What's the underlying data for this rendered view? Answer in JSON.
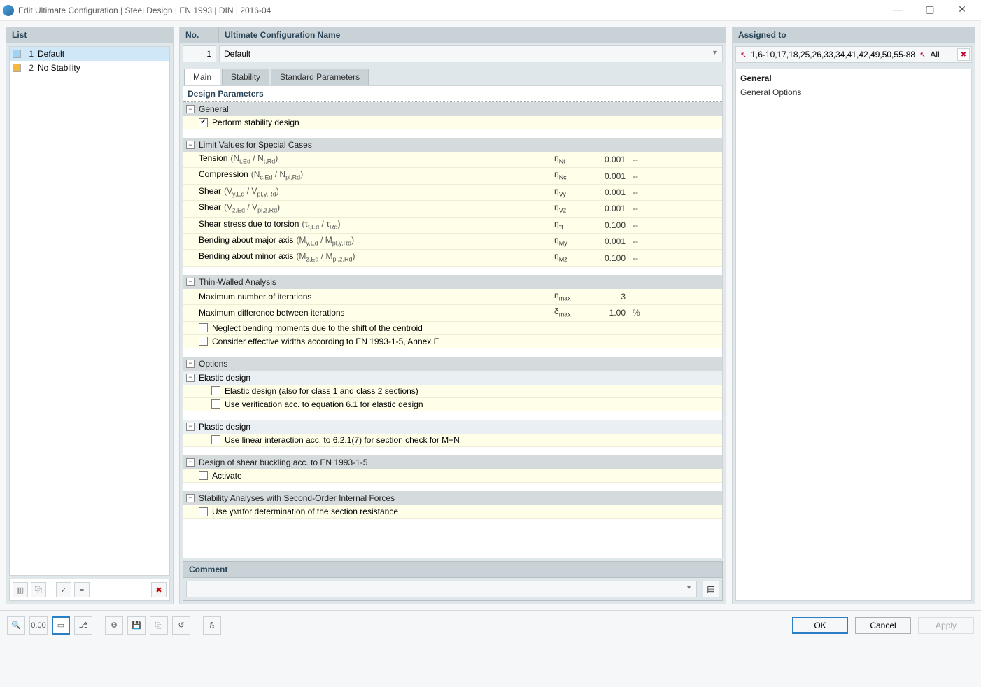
{
  "window_title": "Edit Ultimate Configuration | Steel Design | EN 1993 | DIN | 2016-04",
  "list": {
    "header": "List",
    "items": [
      {
        "num": "1",
        "label": "Default",
        "color": "#9ed4f4",
        "selected": true
      },
      {
        "num": "2",
        "label": "No Stability",
        "color": "#f4b83a",
        "selected": false
      }
    ]
  },
  "no_header": "No.",
  "name_header": "Ultimate Configuration Name",
  "no_value": "1",
  "name_value": "Default",
  "tabs": [
    {
      "id": "main",
      "label": "Main",
      "active": true
    },
    {
      "id": "stability",
      "label": "Stability",
      "active": false
    },
    {
      "id": "standard",
      "label": "Standard Parameters",
      "active": false
    }
  ],
  "design_params_header": "Design Parameters",
  "groups": {
    "general": {
      "title": "General",
      "perform_stability": {
        "checked": true,
        "label": "Perform stability design"
      }
    },
    "limits": {
      "title": "Limit Values for Special Cases",
      "rows": [
        {
          "label": "Tension",
          "paren": "(N_t,Ed / N_t,Rd)",
          "sym": "η_Nt",
          "val": "0.001",
          "unit": "--"
        },
        {
          "label": "Compression",
          "paren": "(N_c,Ed / N_pl,Rd)",
          "sym": "η_Nc",
          "val": "0.001",
          "unit": "--"
        },
        {
          "label": "Shear",
          "paren": "(V_y,Ed / V_pl,y,Rd)",
          "sym": "η_Vy",
          "val": "0.001",
          "unit": "--"
        },
        {
          "label": "Shear",
          "paren": "(V_z,Ed / V_pl,z,Rd)",
          "sym": "η_Vz",
          "val": "0.001",
          "unit": "--"
        },
        {
          "label": "Shear stress due to torsion",
          "paren": "(τ_t,Ed / τ_Rd)",
          "sym": "η_τt",
          "val": "0.100",
          "unit": "--"
        },
        {
          "label": "Bending about major axis",
          "paren": "(M_y,Ed / M_pl,y,Rd)",
          "sym": "η_My",
          "val": "0.001",
          "unit": "--"
        },
        {
          "label": "Bending about minor axis",
          "paren": "(M_z,Ed / M_pl,z,Rd)",
          "sym": "η_Mz",
          "val": "0.100",
          "unit": "--"
        }
      ]
    },
    "thinwall": {
      "title": "Thin-Walled Analysis",
      "iter": {
        "label": "Maximum number of iterations",
        "sym": "n_max",
        "val": "3",
        "unit": ""
      },
      "diff": {
        "label": "Maximum difference between iterations",
        "sym": "δ_max",
        "val": "1.00",
        "unit": "%"
      },
      "neglect": {
        "checked": false,
        "label": "Neglect bending moments due to the shift of the centroid"
      },
      "consider": {
        "checked": false,
        "label": "Consider effective widths according to EN 1993-1-5, Annex E"
      }
    },
    "options": {
      "title": "Options",
      "elastic": {
        "title": "Elastic design",
        "c1": {
          "checked": false,
          "label": "Elastic design (also for class 1 and class 2 sections)"
        },
        "c2": {
          "checked": false,
          "label": "Use verification acc. to equation 6.1 for elastic design"
        }
      },
      "plastic": {
        "title": "Plastic design",
        "c1": {
          "checked": false,
          "label": "Use linear interaction acc. to 6.2.1(7) for section check for M+N"
        }
      }
    },
    "shear_buckling": {
      "title": "Design of shear buckling acc. to EN 1993-1-5",
      "activate": {
        "checked": false,
        "label": "Activate"
      }
    },
    "stability_so": {
      "title": "Stability Analyses with Second-Order Internal Forces",
      "gamma": {
        "checked": false,
        "label_prefix": "Use γ",
        "label_sub": "M1",
        "label_suffix": " for determination of the section resistance"
      }
    }
  },
  "comment_header": "Comment",
  "comment_value": "",
  "assigned": {
    "header": "Assigned to",
    "text": "1,6-10,17,18,25,26,33,34,41,42,49,50,55-88",
    "all": "All"
  },
  "info": {
    "header": "General",
    "text": "General Options"
  },
  "buttons": {
    "ok": "OK",
    "cancel": "Cancel",
    "apply": "Apply"
  }
}
